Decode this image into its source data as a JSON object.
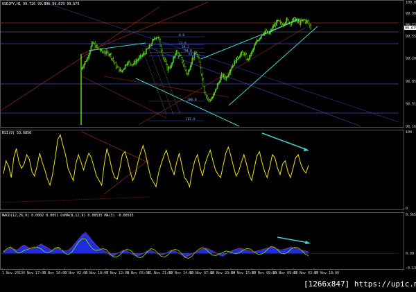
{
  "watermark": "[1266x847] https://upic.me/",
  "chart_data": [
    {
      "type": "candlestick",
      "symbol": "USDJPY",
      "timeframe": "H1",
      "header": "USDJPY,H1  99.726 99.896 99.670 99.679",
      "ylim": [
        98.165,
        100.074
      ],
      "y_ticks": [
        100.074,
        99.904,
        99.726,
        99.675,
        99.55,
        99.209,
        98.859,
        98.514,
        98.165
      ],
      "current_price": 99.679,
      "fib_levels": [
        {
          "label": "0.0",
          "value": 99.54
        },
        {
          "label": "23.6",
          "value": 99.42
        },
        {
          "label": "38.2",
          "value": 99.36
        },
        {
          "label": "50.0",
          "value": 99.3
        },
        {
          "label": "61.8",
          "value": 99.25
        },
        {
          "label": "100.0",
          "value": 98.55
        },
        {
          "label": "161.8",
          "value": 98.25
        }
      ],
      "price_path": [
        [
          0,
          99.05
        ],
        [
          4,
          99.2
        ],
        [
          8,
          99.45
        ],
        [
          12,
          99.35
        ],
        [
          16,
          99.3
        ],
        [
          20,
          99.28
        ],
        [
          24,
          99.1
        ],
        [
          28,
          99.0
        ],
        [
          32,
          99.15
        ],
        [
          36,
          99.12
        ],
        [
          40,
          99.2
        ],
        [
          44,
          99.28
        ],
        [
          48,
          99.4
        ],
        [
          52,
          99.55
        ],
        [
          54,
          99.52
        ],
        [
          57,
          99.25
        ],
        [
          60,
          99.05
        ],
        [
          63,
          99.1
        ],
        [
          66,
          99.32
        ],
        [
          70,
          99.2
        ],
        [
          74,
          98.95
        ],
        [
          77,
          99.18
        ],
        [
          80,
          99.3
        ],
        [
          83,
          99.1
        ],
        [
          86,
          98.7
        ],
        [
          89,
          98.55
        ],
        [
          92,
          98.62
        ],
        [
          95,
          98.8
        ],
        [
          98,
          98.95
        ],
        [
          101,
          98.9
        ],
        [
          104,
          99.05
        ],
        [
          107,
          99.15
        ],
        [
          110,
          99.25
        ],
        [
          113,
          99.3
        ],
        [
          116,
          99.18
        ],
        [
          119,
          99.3
        ],
        [
          122,
          99.45
        ],
        [
          125,
          99.55
        ],
        [
          128,
          99.62
        ],
        [
          131,
          99.58
        ],
        [
          134,
          99.7
        ],
        [
          137,
          99.78
        ],
        [
          140,
          99.72
        ],
        [
          143,
          99.8
        ],
        [
          146,
          99.76
        ],
        [
          149,
          99.82
        ],
        [
          152,
          99.75
        ],
        [
          155,
          99.8
        ],
        [
          158,
          99.77
        ],
        [
          160,
          99.68
        ]
      ]
    },
    {
      "type": "line",
      "title": "RSI(9) 53.6856",
      "ylim": [
        0,
        100
      ],
      "y_ticks": [
        100,
        0
      ],
      "values": [
        45,
        62,
        55,
        40,
        66,
        78,
        60,
        52,
        58,
        70,
        64,
        48,
        42,
        55,
        72,
        60,
        50,
        38,
        30,
        44,
        66,
        90,
        96,
        82,
        70,
        52,
        44,
        36,
        58,
        70,
        60,
        50,
        62,
        72,
        66,
        54,
        42,
        36,
        30,
        58,
        78,
        66,
        50,
        40,
        38,
        52,
        70,
        74,
        62,
        48,
        36,
        44,
        60,
        72,
        82,
        70,
        54,
        40,
        34,
        28,
        46,
        58,
        68,
        76,
        64,
        52,
        44,
        60,
        72,
        56,
        40,
        36,
        28,
        48,
        62,
        70,
        54,
        42,
        58,
        68,
        76,
        62,
        50,
        44,
        40,
        56,
        72,
        80,
        68,
        54,
        42,
        48,
        60,
        70,
        58,
        44,
        36,
        52,
        68,
        74,
        60,
        48,
        40,
        54,
        70,
        66,
        52,
        44,
        58,
        62,
        48,
        40,
        52,
        66,
        70,
        58,
        50,
        46,
        56
      ]
    },
    {
      "type": "histogram",
      "title": "MACD(12,26,9) 0.0002 0.0051 OsMA(8,12,9) 0.00535 MA(3) -0.00535",
      "ylim": [
        -0.1357,
        0.365
      ],
      "y_ticks": [
        0.365,
        0.0,
        -0.1357
      ],
      "values": [
        0.02,
        0.03,
        0.05,
        0.04,
        0.03,
        0.06,
        0.08,
        0.06,
        0.04,
        0.05,
        0.07,
        0.09,
        0.07,
        0.05,
        0.03,
        0.04,
        0.05,
        0.03,
        0.02,
        0.03,
        0.06,
        0.1,
        0.14,
        0.18,
        0.2,
        0.16,
        0.12,
        0.08,
        0.05,
        0.03,
        0.01,
        -0.02,
        -0.03,
        -0.01,
        0.01,
        0.03,
        0.02,
        0.0,
        -0.02,
        -0.03,
        -0.02,
        0.0,
        0.02,
        0.03,
        0.01,
        -0.01,
        -0.02,
        -0.01,
        0.01,
        0.03,
        0.02,
        0.0,
        -0.02,
        -0.04,
        -0.03,
        -0.01,
        0.01,
        0.02,
        0.04,
        0.05,
        0.04,
        0.02,
        0.0,
        -0.02,
        -0.03,
        -0.01,
        0.01,
        0.03,
        0.04,
        0.05,
        0.04,
        0.03,
        0.02,
        0.01,
        0.02,
        0.03,
        0.04,
        0.05,
        0.06,
        0.05,
        0.04,
        0.03,
        0.04,
        0.05,
        0.06,
        0.05,
        0.04,
        0.03,
        0.02,
        0.01
      ]
    }
  ],
  "x_labels": [
    "1 Nov 2013",
    "4 Nov 17:00",
    "5 Nov 10:00",
    "6 Nov 02:00",
    "6 Nov 18:00",
    "7 Nov 12:00",
    "8 Nov 05:00",
    "11 Nov 21:00",
    "12 Nov 14:00",
    "13 Nov 07:00",
    "13 Nov 23:00",
    "14 Nov 15:00",
    "15 Nov 08:00",
    "18 Nov 09:00",
    "17 Nov 02:00",
    "17 Nov 18:00"
  ],
  "colors": {
    "candle_up": "#22c55e",
    "price_line": "#7cfc00",
    "rsi": "#f5e11a",
    "macd_hist": "#1f2bdc",
    "macd_line": "#7cfc00",
    "trend_cyan": "#48d1cc",
    "trend_red": "#a12a12",
    "hline_blue": "#3a4fc6",
    "grid": "#3a3a3a"
  }
}
